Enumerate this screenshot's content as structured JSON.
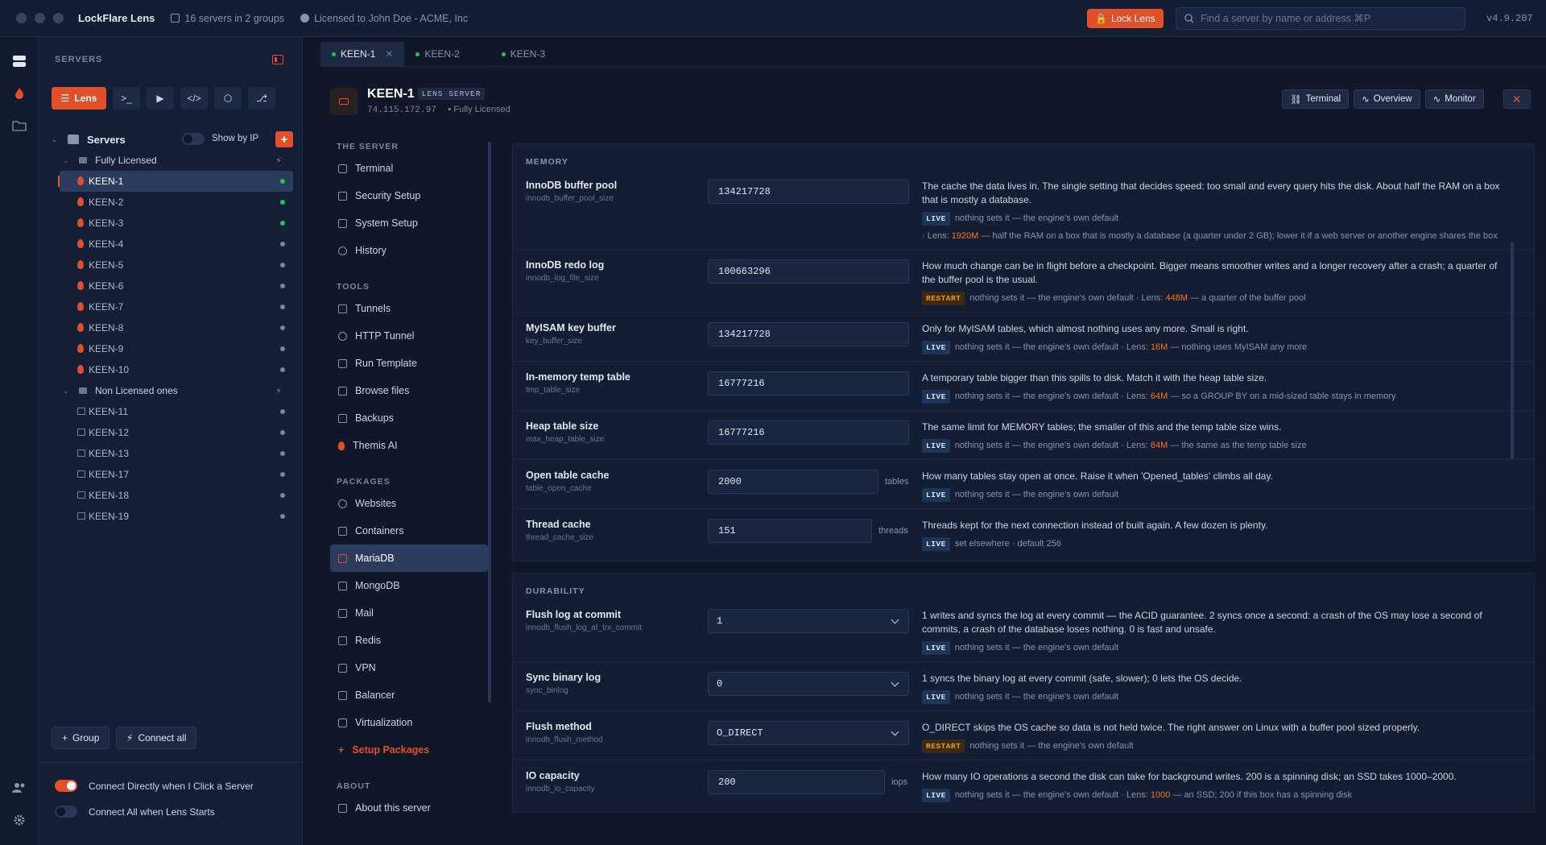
{
  "app": {
    "title": "LockFlare Lens",
    "servers_summary": "16 servers in 2 groups",
    "license": "Licensed to John Doe - ACME, Inc",
    "lock_label": "Lock Lens",
    "search_placeholder": "Find a server by name or address ⌘P",
    "version": "v4.9.207"
  },
  "sidebar": {
    "heading": "SERVERS",
    "lens_label": "Lens",
    "root_label": "Servers",
    "show_by_ip": "Show by IP",
    "groups": [
      {
        "name": "Fully Licensed",
        "servers": [
          "KEEN-1",
          "KEEN-2",
          "KEEN-3",
          "KEEN-4",
          "KEEN-5",
          "KEEN-6",
          "KEEN-7",
          "KEEN-8",
          "KEEN-9",
          "KEEN-10"
        ]
      },
      {
        "name": "Non Licensed ones",
        "servers": [
          "KEEN-11",
          "KEEN-12",
          "KEEN-13",
          "KEEN-17",
          "KEEN-18",
          "KEEN-19"
        ]
      }
    ],
    "group_btn": "Group",
    "connect_all_btn": "Connect all",
    "opt_connect_direct": "Connect Directly when I Click a Server",
    "opt_connect_all": "Connect All when Lens Starts"
  },
  "tabs": [
    {
      "label": "KEEN-1"
    },
    {
      "label": "KEEN-2"
    },
    {
      "label": "KEEN-3"
    }
  ],
  "server": {
    "name": "KEEN-1",
    "badge": "LENS SERVER",
    "ip": "74.115.172.97",
    "license": "Fully Licensed"
  },
  "header_buttons": {
    "terminal": "Terminal",
    "overview": "Overview",
    "monitor": "Monitor"
  },
  "nav": {
    "sec_server": "THE SERVER",
    "terminal": "Terminal",
    "security": "Security Setup",
    "system": "System Setup",
    "history": "History",
    "sec_tools": "TOOLS",
    "tunnels": "Tunnels",
    "http_tunnel": "HTTP Tunnel",
    "run_template": "Run Template",
    "browse_files": "Browse files",
    "backups": "Backups",
    "themis": "Themis AI",
    "sec_packages": "PACKAGES",
    "websites": "Websites",
    "containers": "Containers",
    "mariadb": "MariaDB",
    "mongodb": "MongoDB",
    "mail": "Mail",
    "redis": "Redis",
    "vpn": "VPN",
    "balancer": "Balancer",
    "virtualization": "Virtualization",
    "setup_packages": "Setup Packages",
    "sec_about": "ABOUT",
    "about": "About this server"
  },
  "memory": {
    "title": "MEMORY",
    "settings": [
      {
        "label": "InnoDB buffer pool",
        "key": "innodb_buffer_pool_size",
        "value": "134217728",
        "desc": "The cache the data lives in. The single setting that decides speed: too small and every query hits the disk. About half the RAM on a box that is mostly a database.",
        "tag": "LIVE",
        "meta": "nothing sets it — the engine's own default",
        "lens_pre": "· Lens: ",
        "lens_val": "1920M",
        "lens_post": " — half the RAM on a box that is mostly a database (a quarter under 2 GB); lower it if a web server or another engine shares the box"
      },
      {
        "label": "InnoDB redo log",
        "key": "innodb_log_file_size",
        "value": "100663296",
        "desc": "How much change can be in flight before a checkpoint. Bigger means smoother writes and a longer recovery after a crash; a quarter of the buffer pool is the usual.",
        "tag": "RESTART",
        "meta": "nothing sets it — the engine's own default",
        "lens_pre": " · Lens: ",
        "lens_val": "448M",
        "lens_post": " — a quarter of the buffer pool"
      },
      {
        "label": "MyISAM key buffer",
        "key": "key_buffer_size",
        "value": "134217728",
        "desc": "Only for MyISAM tables, which almost nothing uses any more. Small is right.",
        "tag": "LIVE",
        "meta": "nothing sets it — the engine's own default",
        "lens_pre": " · Lens: ",
        "lens_val": "16M",
        "lens_post": " — nothing uses MyISAM any more"
      },
      {
        "label": "In-memory temp table",
        "key": "tmp_table_size",
        "value": "16777216",
        "desc": "A temporary table bigger than this spills to disk. Match it with the heap table size.",
        "tag": "LIVE",
        "meta": "nothing sets it — the engine's own default",
        "lens_pre": " · Lens: ",
        "lens_val": "64M",
        "lens_post": " — so a GROUP BY on a mid-sized table stays in memory"
      },
      {
        "label": "Heap table size",
        "key": "max_heap_table_size",
        "value": "16777216",
        "desc": "The same limit for MEMORY tables; the smaller of this and the temp table size wins.",
        "tag": "LIVE",
        "meta": "nothing sets it — the engine's own default",
        "lens_pre": " · Lens: ",
        "lens_val": "64M",
        "lens_post": " — the same as the temp table size"
      },
      {
        "label": "Open table cache",
        "key": "table_open_cache",
        "value": "2000",
        "unit": "tables",
        "desc": "How many tables stay open at once. Raise it when 'Opened_tables' climbs all day.",
        "tag": "LIVE",
        "meta": "nothing sets it — the engine's own default"
      },
      {
        "label": "Thread cache",
        "key": "thread_cache_size",
        "value": "151",
        "unit": "threads",
        "desc": "Threads kept for the next connection instead of built again. A few dozen is plenty.",
        "tag": "LIVE",
        "meta": "set elsewhere · default 256"
      }
    ]
  },
  "durability": {
    "title": "DURABILITY",
    "settings": [
      {
        "label": "Flush log at commit",
        "key": "innodb_flush_log_at_trx_commit",
        "select": "1",
        "desc": "1 writes and syncs the log at every commit — the ACID guarantee. 2 syncs once a second: a crash of the OS may lose a second of commits, a crash of the database loses nothing. 0 is fast and unsafe.",
        "tag": "LIVE",
        "meta": "nothing sets it — the engine's own default"
      },
      {
        "label": "Sync binary log",
        "key": "sync_binlog",
        "select": "0",
        "desc": "1 syncs the binary log at every commit (safe, slower); 0 lets the OS decide.",
        "tag": "LIVE",
        "meta": "nothing sets it — the engine's own default"
      },
      {
        "label": "Flush method",
        "key": "innodb_flush_method",
        "select": "O_DIRECT",
        "desc": "O_DIRECT skips the OS cache so data is not held twice. The right answer on Linux with a buffer pool sized properly.",
        "tag": "RESTART",
        "meta": "nothing sets it — the engine's own default"
      },
      {
        "label": "IO capacity",
        "key": "innodb_io_capacity",
        "value": "200",
        "unit": "iops",
        "desc": "How many IO operations a second the disk can take for background writes. 200 is a spinning disk; an SSD takes 1000–2000.",
        "tag": "LIVE",
        "meta": "nothing sets it — the engine's own default",
        "lens_pre": " · Lens: ",
        "lens_val": "1000",
        "lens_post": " — an SSD; 200 if this box has a spinning disk"
      }
    ]
  }
}
